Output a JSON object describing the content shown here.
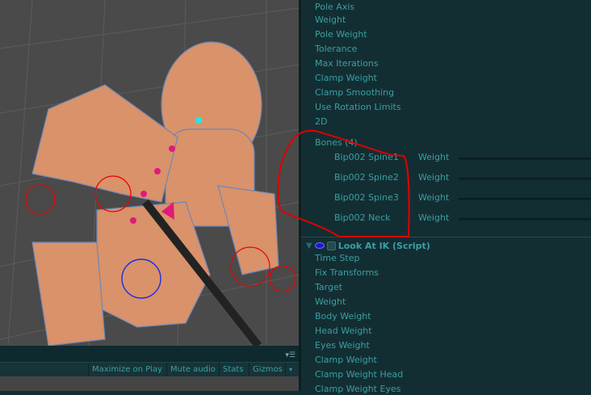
{
  "scene_toolbar": {
    "maximize_on_play": "Maximize on Play",
    "mute_audio": "Mute audio",
    "stats": "Stats",
    "gizmos": "Gizmos"
  },
  "limb_ik": {
    "partial_top_label": "Pole Axis",
    "fields": [
      "Weight",
      "Pole Weight",
      "Tolerance",
      "Max Iterations",
      "Clamp Weight",
      "Clamp Smoothing",
      "Use Rotation Limits",
      "2D"
    ],
    "bones_label": "Bones (4)",
    "bones": [
      {
        "name": "Bip002 Spine1",
        "weight_label": "Weight"
      },
      {
        "name": "Bip002 Spine2",
        "weight_label": "Weight"
      },
      {
        "name": "Bip002 Spine3",
        "weight_label": "Weight"
      },
      {
        "name": "Bip002 Neck",
        "weight_label": "Weight"
      }
    ]
  },
  "look_at_ik": {
    "title": "Look At IK (Script)",
    "fields": [
      "Time Step",
      "Fix Transforms",
      "Target",
      "Weight",
      "Body Weight",
      "Head Weight",
      "Eyes Weight",
      "Clamp Weight",
      "Clamp Weight Head",
      "Clamp Weight Eyes"
    ]
  },
  "colors": {
    "annotation": "#e00000",
    "text": "#3a9fa2",
    "panel": "#132e33"
  }
}
